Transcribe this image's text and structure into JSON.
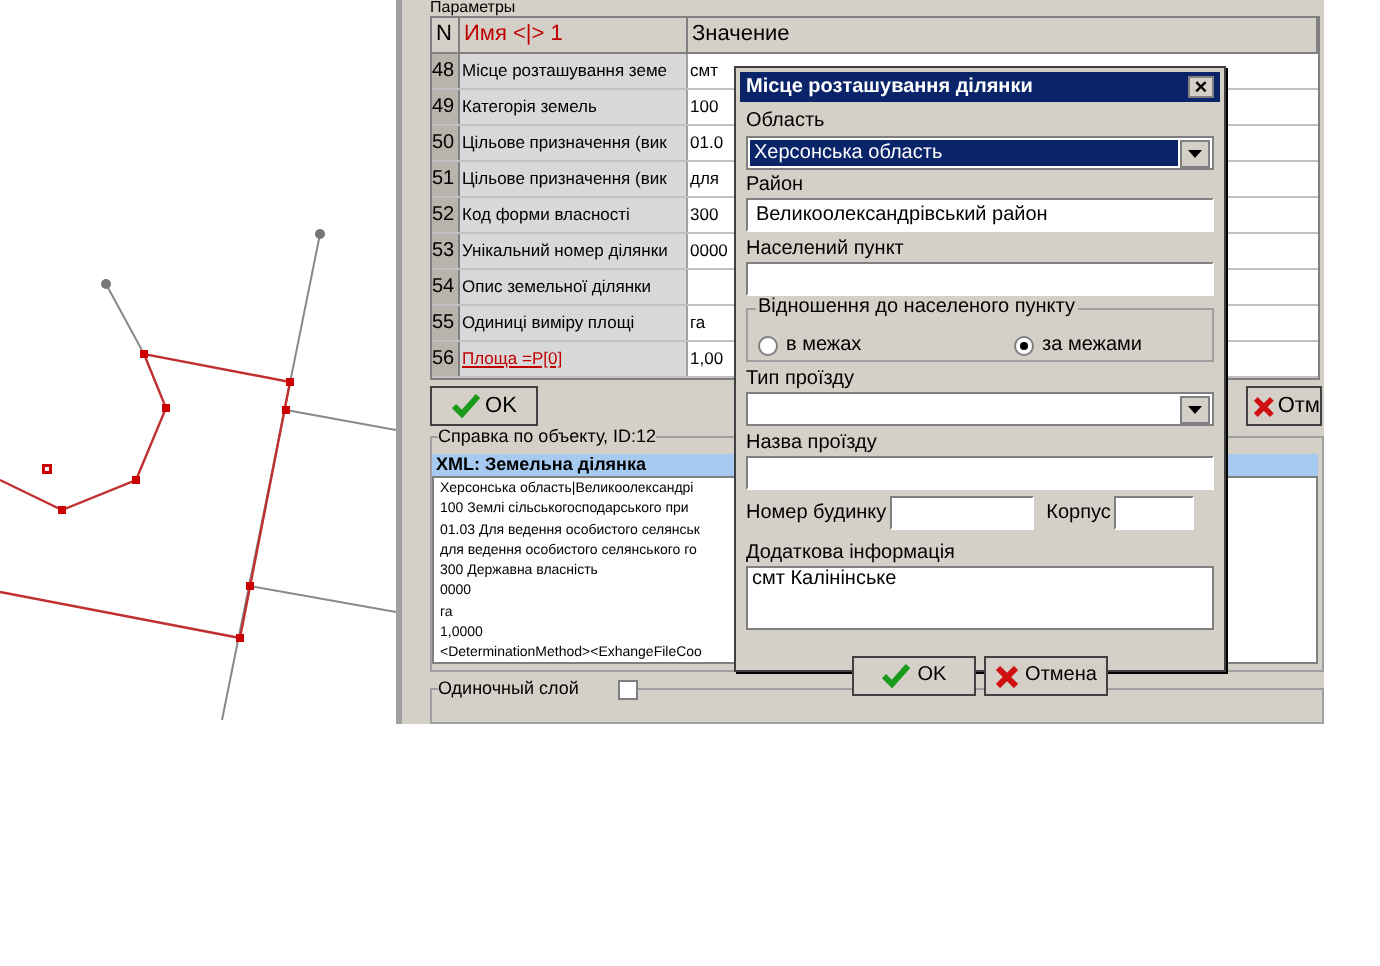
{
  "params_panel": {
    "tab": "Параметры",
    "columns": [
      "N",
      "Имя <|> 1",
      "Значение"
    ],
    "rows": [
      {
        "n": "48",
        "name": "Місце розташування земе",
        "value": "смт",
        "kind": "text"
      },
      {
        "n": "49",
        "name": "Категорія земель",
        "value": "100",
        "kind": "text"
      },
      {
        "n": "50",
        "name": "Цільове призначення (вик",
        "value": "01.0",
        "kind": "text"
      },
      {
        "n": "51",
        "name": "Цільове призначення (вик",
        "value": "для",
        "kind": "text"
      },
      {
        "n": "52",
        "name": "Код форми власності",
        "value": "300",
        "kind": "text"
      },
      {
        "n": "53",
        "name": "Унікальний номер ділянки",
        "value": "0000",
        "kind": "text"
      },
      {
        "n": "54",
        "name": "Опис земельної ділянки",
        "kind": "text"
      },
      {
        "n": "55",
        "name": "Одиниці виміру площі",
        "value": "га",
        "kind": "text"
      },
      {
        "n": "56",
        "name": "Площа =P[0]",
        "value": "1,00",
        "kind": "link"
      }
    ],
    "ok_button": "OK",
    "cancel_button": "Отм"
  },
  "info_box": {
    "title": "Справка по объекту, ID:12",
    "header": "XML: Земельна ділянка",
    "lines": [
      "Херсонська область|Великоолександрі",
      "100 Землі сільськогосподарського при",
      "01.03 Для ведення особистого селянськ",
      "для ведення особистого селянського го",
      "300 Державна власність",
      "0000",
      "га",
      "1,0000",
      "<DeterminationMethod><ExhangeFileCoo"
    ]
  },
  "layer_box": {
    "title": "Одиночный слой",
    "checked": false
  },
  "dialog": {
    "title": "Місце розташування ділянки",
    "close": "×",
    "region_label": "Область",
    "region_value": "Херсонська область",
    "district_label": "Район",
    "district_value": "Великоолександрівський район",
    "settlement_label": "Населений пункт",
    "relation_title": "Відношення до населеного пункту",
    "relation_options": [
      {
        "label": "в межах",
        "selected": false
      },
      {
        "label": "за межами",
        "selected": true
      }
    ],
    "passage_type_label": "Тип проїзду",
    "passage_name_label": "Назва проїзду",
    "house_label": "Номер будинку",
    "block_label": "Корпус",
    "extra_label": "Додаткова інформація",
    "extra_value": "смт Калінінське",
    "ok_button": "OK",
    "cancel_button": "Отмена"
  }
}
